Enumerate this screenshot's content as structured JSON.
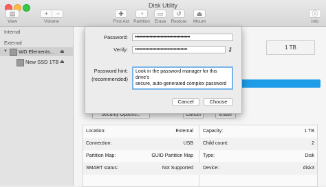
{
  "window": {
    "title": "Disk Utility"
  },
  "toolbar": {
    "view_label": "View",
    "volume_label": "Volume",
    "volume_add_glyph": "+",
    "volume_remove_glyph": "−",
    "first_aid_label": "First Aid",
    "partition_label": "Partition",
    "erase_label": "Erase",
    "restore_label": "Restore",
    "mount_label": "Mount",
    "info_label": "Info",
    "icons": [
      "view-icon",
      "first-aid-icon",
      "partition-icon",
      "erase-icon",
      "restore-icon",
      "mount-icon",
      "info-icon"
    ]
  },
  "sidebar": {
    "internal_header": "Internal",
    "external_header": "External",
    "items": [
      {
        "label": "WD Elements...",
        "selected": true,
        "eject": "⏏"
      },
      {
        "label": "New SSD 1TB",
        "selected": false,
        "eject": "⏏"
      }
    ]
  },
  "main": {
    "capacity_badge": "1 TB",
    "usage_color": "#1f9ce8",
    "security_button": "Security Options...",
    "under_cancel_button": "Cancel",
    "under_erase_button": "Erase",
    "info_rows": [
      {
        "left_label": "Location:",
        "left_value": "External",
        "right_label": "Capacity:",
        "right_value": "1 TB"
      },
      {
        "left_label": "Connection:",
        "left_value": "USB",
        "right_label": "Child count:",
        "right_value": "2"
      },
      {
        "left_label": "Partition Map:",
        "left_value": "GUID Partition Map",
        "right_label": "Type:",
        "right_value": "Disk"
      },
      {
        "left_label": "SMART status:",
        "left_value": "Not Supported",
        "right_label": "Device:",
        "right_value": "disk3"
      }
    ]
  },
  "dialog": {
    "password_label": "Password:",
    "password_value": "•••••••••••••••••••••••••••••••••••••••••",
    "verify_label": "Verify:",
    "verify_value": "•••••••••••••••••••••••••••••••••••••••",
    "hint_label": "Password hint:",
    "hint_sublabel": "(recommended)",
    "hint_value": "Look in the password manager for this drive's\nsecure, auto-generated complex password",
    "cancel_button": "Cancel",
    "choose_button": "Choose",
    "accent_color": "#7ab5ea"
  }
}
